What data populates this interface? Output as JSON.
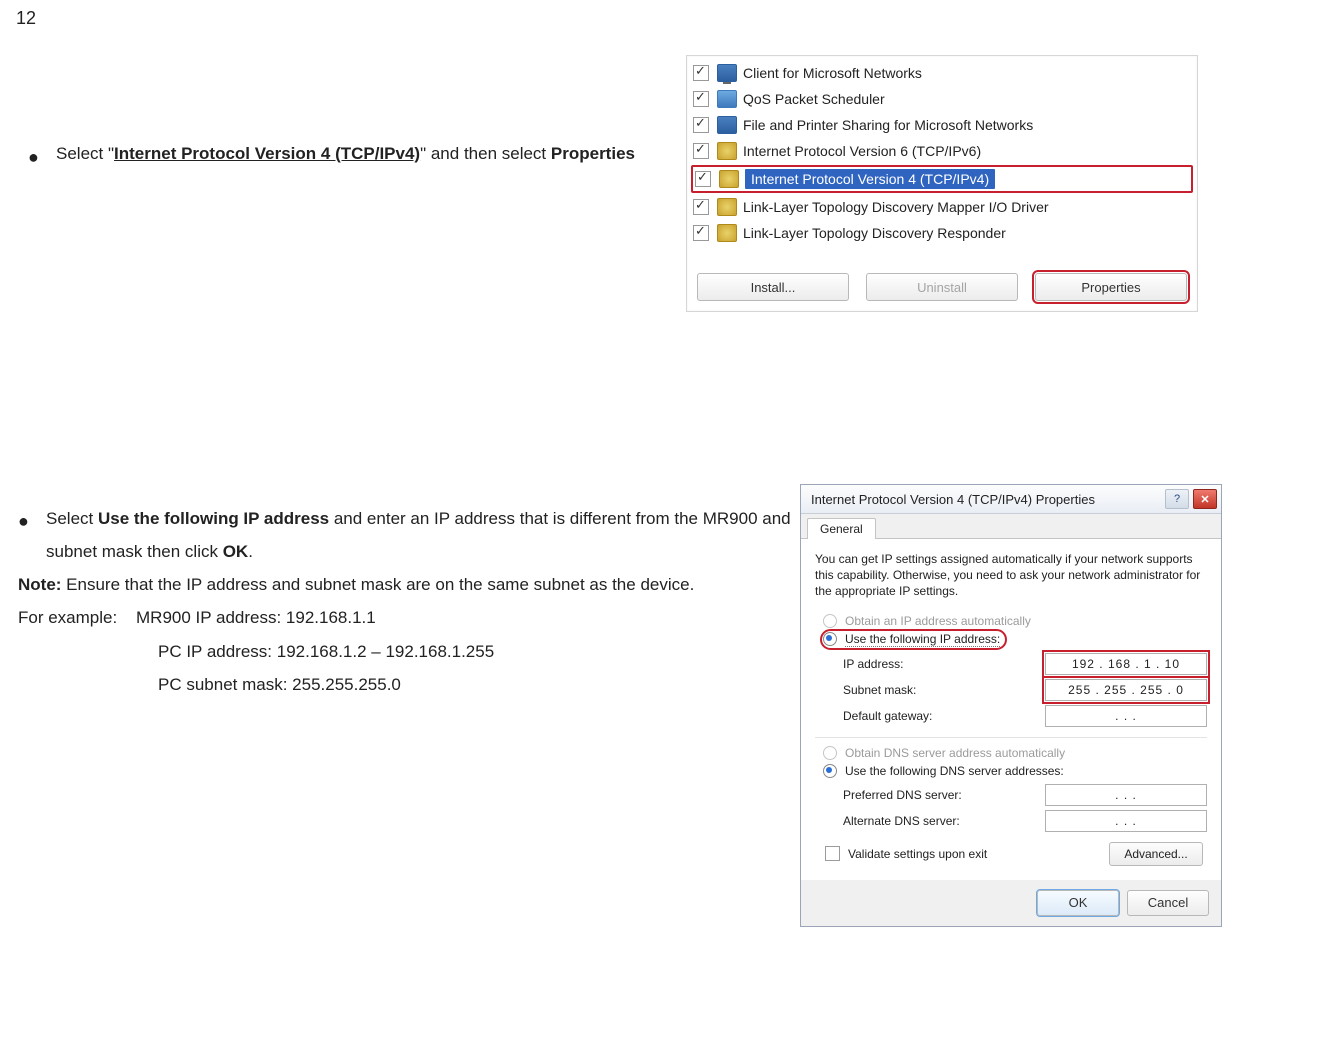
{
  "page_number": "12",
  "section1": {
    "pre": "Select \"",
    "bold": "Internet Protocol Version 4 (TCP/IPv4)",
    "mid": "\" and then select ",
    "bold2": "Properties"
  },
  "panel1": {
    "items": [
      {
        "label": "Client for Microsoft Networks",
        "icon": "monitor"
      },
      {
        "label": "QoS Packet Scheduler",
        "icon": "qos"
      },
      {
        "label": "File and Printer Sharing for Microsoft Networks",
        "icon": "share"
      },
      {
        "label": "Internet Protocol Version 6 (TCP/IPv6)",
        "icon": "proto"
      },
      {
        "label": "Internet Protocol Version 4 (TCP/IPv4)",
        "icon": "proto",
        "highlighted": true
      },
      {
        "label": "Link-Layer Topology Discovery Mapper I/O Driver",
        "icon": "proto"
      },
      {
        "label": "Link-Layer Topology Discovery Responder",
        "icon": "proto"
      }
    ],
    "install": "Install...",
    "uninstall": "Uninstall",
    "properties": "Properties"
  },
  "section2": {
    "bullet_pre": "Select ",
    "bullet_bold1": "Use the following IP address",
    "bullet_mid": " and enter an IP address that is different from the MR900 and subnet mask then click ",
    "bullet_bold2": "OK",
    "bullet_end": ".",
    "note_label": "Note:",
    "note_text": " Ensure that the IP address and subnet mask are on the same subnet as the device.",
    "example_label": "For example:",
    "example_line1": "MR900 IP address: 192.168.1.1",
    "example_line2": "PC IP address: 192.168.1.2 – 192.168.1.255",
    "example_line3": "PC subnet mask: 255.255.255.0"
  },
  "dlg": {
    "title": "Internet Protocol Version 4 (TCP/IPv4) Properties",
    "tab": "General",
    "desc": "You can get IP settings assigned automatically if your network supports this capability. Otherwise, you need to ask your network administrator for the appropriate IP settings.",
    "r_auto_ip": "Obtain an IP address automatically",
    "r_use_ip": "Use the following IP address:",
    "ip_label": "IP address:",
    "ip_value": "192 . 168 .  1  . 10",
    "mask_label": "Subnet mask:",
    "mask_value": "255 . 255 . 255 .  0",
    "gw_label": "Default gateway:",
    "gw_value": ".       .       .",
    "r_auto_dns": "Obtain DNS server address automatically",
    "r_use_dns": "Use the following DNS server addresses:",
    "pdns_label": "Preferred DNS server:",
    "pdns_value": ".       .       .",
    "adns_label": "Alternate DNS server:",
    "adns_value": ".       .       .",
    "validate": "Validate settings upon exit",
    "advanced": "Advanced...",
    "ok": "OK",
    "cancel": "Cancel"
  }
}
